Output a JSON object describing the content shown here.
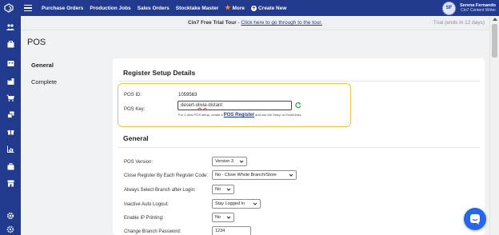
{
  "topbar": {
    "nav": [
      {
        "label": "Purchase Orders"
      },
      {
        "label": "Production Jobs"
      },
      {
        "label": "Sales Orders"
      },
      {
        "label": "Stocktake Master"
      },
      {
        "label": "More"
      },
      {
        "label": "Create New"
      }
    ],
    "user": {
      "initials": "SF",
      "name": "Serena Fernando",
      "role": "Cin7 Content Writer"
    }
  },
  "banner": {
    "title": "Cin7 Free Trial Tour",
    "separator": " - ",
    "link": "Click here to go through to the tour.",
    "trial_status": "Trial (ends in 12 days)"
  },
  "page": {
    "title": "POS"
  },
  "steps": [
    "General",
    "Complete"
  ],
  "register_setup": {
    "title": "Register Setup Details",
    "pos_id_label": "POS ID:",
    "pos_id_value": "1059563",
    "pos_key_label": "POS Key:",
    "pos_key_parts": [
      "desert-",
      "olivia",
      "-distant"
    ],
    "hint_prefix": "For 1-click POS setup, create a ",
    "hint_link": "POS Register",
    "hint_suffix": " and use the Setup or Email links."
  },
  "general": {
    "title": "General",
    "fields": [
      {
        "label": "POS Version:",
        "value": "Version 3"
      },
      {
        "label": "Close Register By Each Register Code:",
        "value": "No - Close Whole Branch/Store"
      },
      {
        "label": "Always Select Branch after Login:",
        "value": "No"
      },
      {
        "label": "Inactive Auto Logout:",
        "value": "Stay Logged In"
      },
      {
        "label": "Enable IP Printing:",
        "value": "No"
      },
      {
        "label": "Change Branch Password:",
        "value": "1234"
      }
    ]
  },
  "colors": {
    "brand": "#213a8e",
    "highlight": "#e8c548",
    "chat": "#2667e8"
  }
}
